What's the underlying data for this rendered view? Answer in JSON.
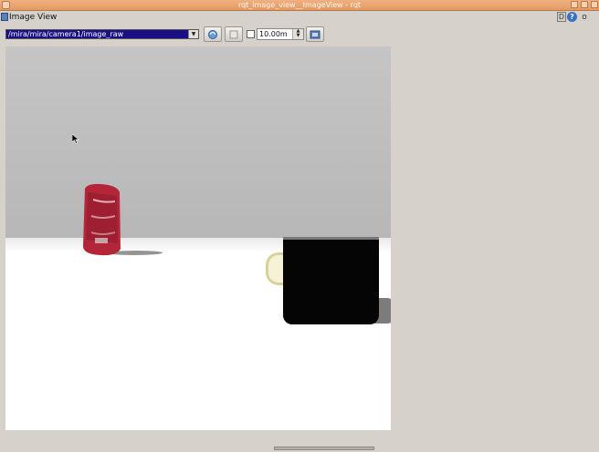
{
  "window": {
    "title": "rqt_image_view__ImageView - rqt"
  },
  "pane": {
    "title": "Image View",
    "d_label": "D",
    "help_label": "?",
    "close_label": "o"
  },
  "toolbar": {
    "topic": "/mira/mira/camera1/image_raw",
    "refresh_icon": "refresh-icon",
    "save_icon": "save-icon",
    "smooth_checked": false,
    "timeout_value": "10.00m",
    "screenshot_icon": "screenshot-icon"
  },
  "colors": {
    "titlebar": "#e39a62",
    "window_bg": "#d6d2cb",
    "topic_highlight": "#1b0f86"
  }
}
